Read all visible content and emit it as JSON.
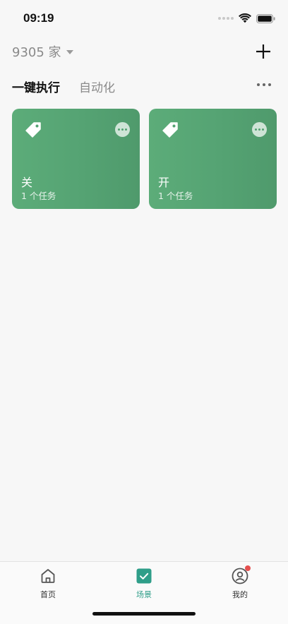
{
  "status_bar": {
    "time": "09:19"
  },
  "header": {
    "home_name": "9305 家"
  },
  "tabs": [
    {
      "label": "一键执行",
      "active": true
    },
    {
      "label": "自动化",
      "active": false
    }
  ],
  "scenes": [
    {
      "title": "关",
      "subtitle": "1 个任务",
      "icon": "tag-icon"
    },
    {
      "title": "开",
      "subtitle": "1 个任务",
      "icon": "tag-icon"
    }
  ],
  "tabbar": [
    {
      "label": "首页",
      "icon": "home-icon",
      "active": false
    },
    {
      "label": "场景",
      "icon": "scene-check-icon",
      "active": true
    },
    {
      "label": "我的",
      "icon": "profile-icon",
      "active": false,
      "badge": true
    }
  ],
  "colors": {
    "card_green": "#55a373",
    "accent_teal": "#2f9e89",
    "badge_red": "#e5504f"
  }
}
